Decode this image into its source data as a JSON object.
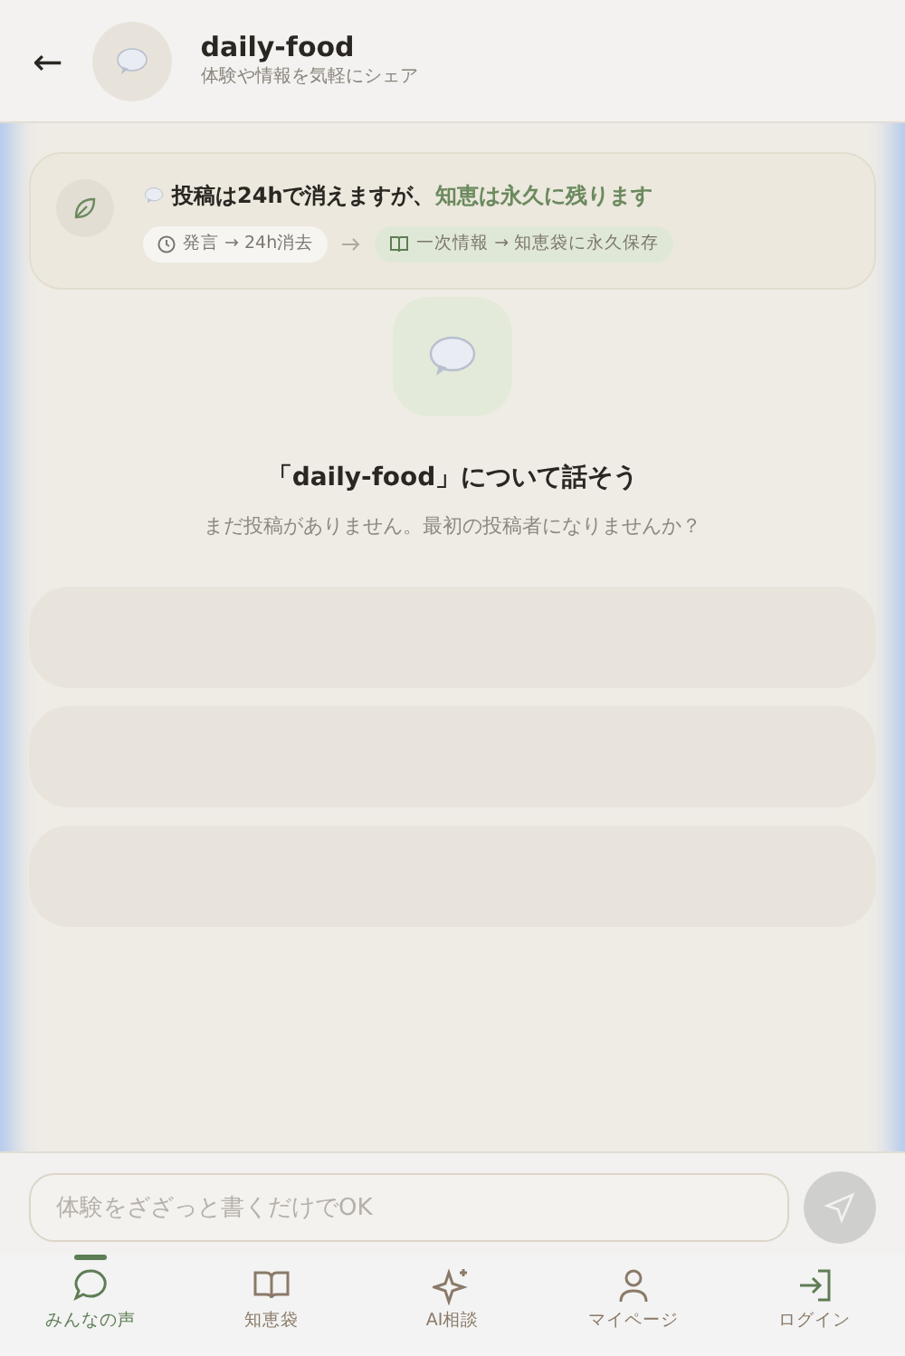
{
  "header": {
    "back_label": "←",
    "title": "daily-food",
    "subtitle": "体験や情報を気軽にシェア"
  },
  "notice": {
    "title_parts": [
      {
        "text": "投稿は24hで消えますが、",
        "kind": "plain"
      },
      {
        "text": "知恵は永久に残ります",
        "kind": "accent"
      }
    ],
    "chips": [
      {
        "kind": "clock",
        "text": "発言 → 24h消去"
      },
      {
        "kind": "book",
        "text": "一次情報 → 知恵袋に永久保存"
      }
    ]
  },
  "empty": {
    "title": "「daily-food」について話そう",
    "message": "まだ投稿がありません。最初の投稿者になりませんか？"
  },
  "composer": {
    "placeholder": "体験をざざっと書くだけでOK"
  },
  "nav": [
    {
      "label": "みんなの声",
      "kind": "chat",
      "selected": true
    },
    {
      "label": "知恵袋",
      "kind": "book",
      "selected": false
    },
    {
      "label": "AI相談",
      "kind": "sparkle",
      "selected": false
    },
    {
      "label": "マイページ",
      "kind": "person",
      "selected": false
    },
    {
      "label": "ログイン",
      "kind": "login",
      "selected": false
    }
  ]
}
